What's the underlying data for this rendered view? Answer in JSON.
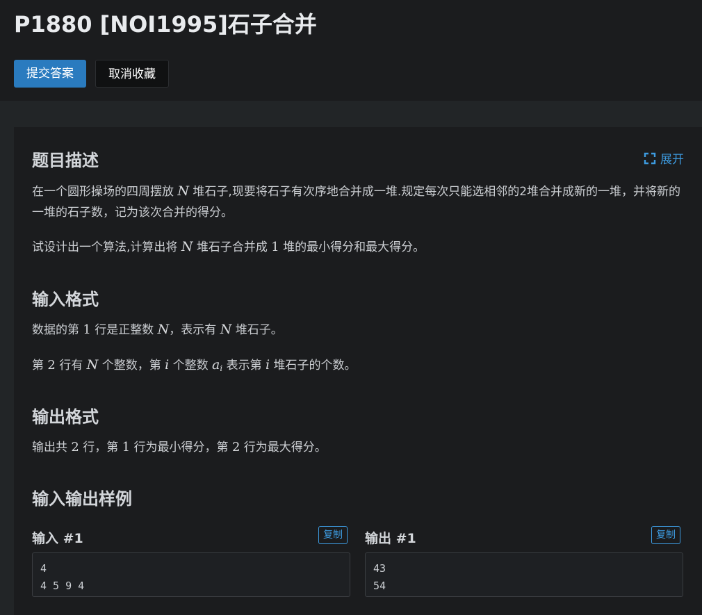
{
  "problem": {
    "title": "P1880 [NOI1995]石子合并",
    "submit_label": "提交答案",
    "unfavorite_label": "取消收藏",
    "expand_label": "展开"
  },
  "description": {
    "heading": "题目描述",
    "p1": {
      "a": "在一个圆形操场的四周摆放 ",
      "var_n": "N",
      "b": " 堆石子,现要将石子有次序地合并成一堆.规定每次只能选相邻的2堆合并成新的一堆，并将新的一堆的石子数，记为该次合并的得分。"
    },
    "p2": {
      "a": "试设计出一个算法,计算出将 ",
      "var_n": "N",
      "b": " 堆石子合并成 ",
      "num": "1",
      "c": " 堆的最小得分和最大得分。"
    }
  },
  "input_format": {
    "heading": "输入格式",
    "l1": {
      "a": "数据的第 ",
      "num": "1",
      "b": " 行是正整数 ",
      "var_n1": "N",
      "c": "，表示有 ",
      "var_n2": "N",
      "d": " 堆石子。"
    },
    "l2": {
      "a": "第 ",
      "num": "2",
      "b": " 行有 ",
      "var_n": "N",
      "c": " 个整数，第 ",
      "var_i1": "i",
      "d": " 个整数 ",
      "var_a": "a",
      "var_sub": "i",
      "e": " 表示第 ",
      "var_i2": "i",
      "f": " 堆石子的个数。"
    }
  },
  "output_format": {
    "heading": "输出格式",
    "l1": {
      "a": "输出共 ",
      "num1": "2",
      "b": " 行，第 ",
      "num2": "1",
      "c": " 行为最小得分，第 ",
      "num3": "2",
      "d": " 行为最大得分。"
    }
  },
  "samples": {
    "heading": "输入输出样例",
    "input_label": "输入 #1",
    "output_label": "输出 #1",
    "copy_label": "复制",
    "input_text": "4\n4 5 9 4",
    "output_text": "43\n54"
  },
  "colors": {
    "primary_button": "#2a7bbf",
    "link_blue": "#3d9be0",
    "background": "#1b1c1e"
  }
}
